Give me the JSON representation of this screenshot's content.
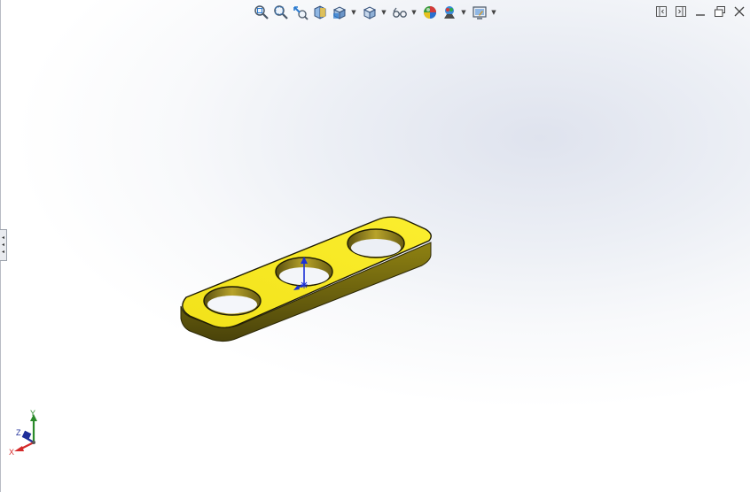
{
  "toolbar": {
    "buttons": [
      {
        "name": "zoom-to-fit-icon",
        "has_dropdown": false
      },
      {
        "name": "zoom-to-area-icon",
        "has_dropdown": false
      },
      {
        "name": "previous-view-icon",
        "has_dropdown": false
      },
      {
        "name": "section-view-icon",
        "has_dropdown": false
      },
      {
        "name": "view-orientation-icon",
        "has_dropdown": true
      },
      {
        "name": "display-style-icon",
        "has_dropdown": true
      },
      {
        "name": "hide-show-items-icon",
        "has_dropdown": true
      },
      {
        "name": "edit-appearance-icon",
        "has_dropdown": false
      },
      {
        "name": "apply-scene-icon",
        "has_dropdown": true
      },
      {
        "name": "view-settings-icon",
        "has_dropdown": true
      }
    ]
  },
  "window_controls": [
    "tile-horizontal-icon",
    "tile-vertical-icon",
    "minimize-icon",
    "restore-icon",
    "close-icon"
  ],
  "triad": {
    "x_label": "X",
    "y_label": "Y",
    "z_label": "Z"
  },
  "colors": {
    "part_top": "#f6e71f",
    "part_side": "#6e6410",
    "hole_wall": "#8a7a16",
    "triad_x": "#d42a2a",
    "triad_y": "#2a8a2a",
    "triad_z": "#1f2f9a",
    "origin_axis": "#1a2fd6"
  }
}
